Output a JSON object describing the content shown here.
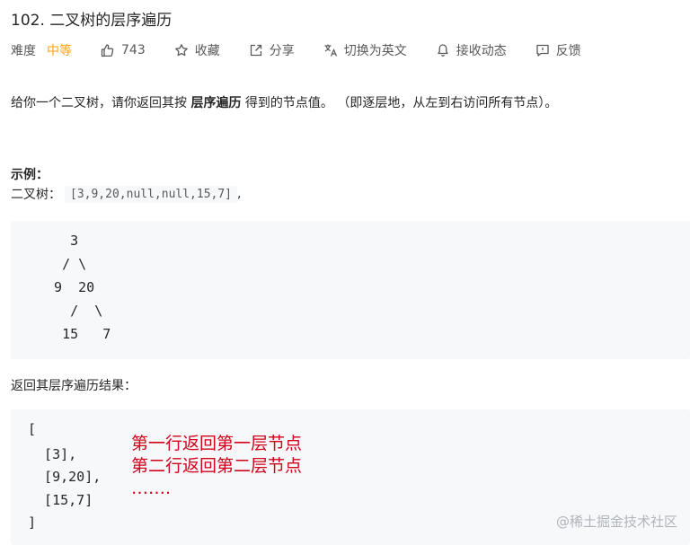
{
  "problem": {
    "title": "102. 二叉树的层序遍历"
  },
  "meta": {
    "difficulty_label": "难度",
    "difficulty_value": "中等",
    "likes": "743",
    "favorite": "收藏",
    "share": "分享",
    "switch_lang": "切换为英文",
    "notify": "接收动态",
    "feedback": "反馈",
    "colors": {
      "difficulty": "#ffa116",
      "annotation": "#d0021b"
    }
  },
  "description": {
    "before": "给你一个二叉树，请你返回其按 ",
    "bold": "层序遍历",
    "after": " 得到的节点值。 （即逐层地，从左到右访问所有节点）。"
  },
  "example": {
    "title": "示例：",
    "input_label": "二叉树：",
    "input_value": "[3,9,20,null,null,15,7]",
    "input_suffix": ",",
    "tree_lines": [
      "    3",
      "   / \\",
      "  9  20",
      "    /  \\",
      "   15   7"
    ],
    "result_label": "返回其层序遍历结果：",
    "result_lines": [
      "[",
      "  [3],",
      "  [9,20],",
      "  [15,7]",
      "]"
    ]
  },
  "annotations": [
    "第一行返回第一层节点",
    "第二行返回第二层节点",
    "……."
  ],
  "watermark": "@稀土掘金技术社区"
}
